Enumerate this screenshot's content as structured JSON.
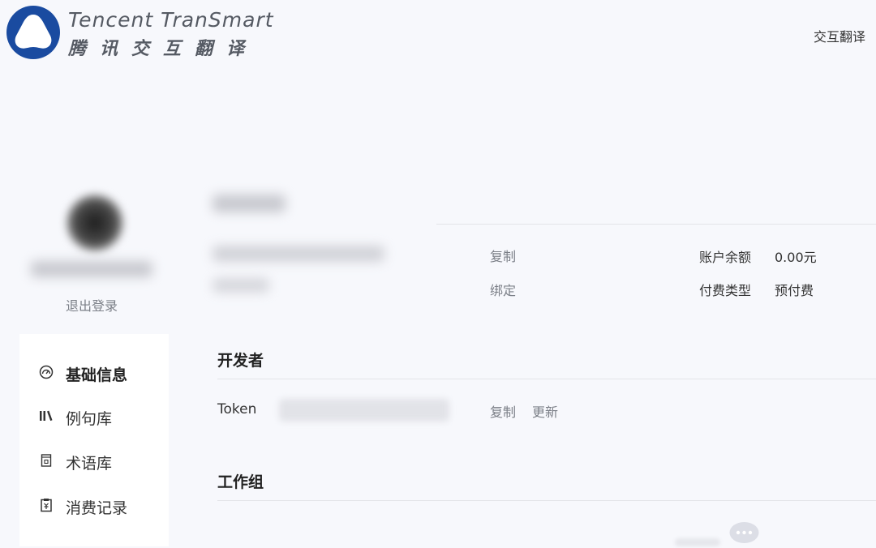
{
  "brand": {
    "name_en": "Tencent TranSmart",
    "name_cn": "腾讯交互翻译"
  },
  "header": {
    "top_link": "交互翻译"
  },
  "profile": {
    "logout_label": "退出登录",
    "copy_label": "复制",
    "bind_label": "绑定",
    "balance_label": "账户余额",
    "balance_value": "0.00元",
    "pay_type_label": "付费类型",
    "pay_type_value": "预付费"
  },
  "sidebar": {
    "items": [
      {
        "label": "基础信息",
        "icon": "dashboard-icon",
        "active": true
      },
      {
        "label": "例句库",
        "icon": "library-icon",
        "active": false
      },
      {
        "label": "术语库",
        "icon": "term-book-icon",
        "active": false
      },
      {
        "label": "消费记录",
        "icon": "receipt-icon",
        "active": false
      }
    ]
  },
  "developer": {
    "title": "开发者",
    "token_label": "Token",
    "copy_label": "复制",
    "refresh_label": "更新"
  },
  "workgroup": {
    "title": "工作组"
  },
  "colors": {
    "page_bg": "#f7f8fc",
    "logo_blue": "#1a4ba0",
    "text_dark": "#333333",
    "text_gray": "#7b7f87"
  }
}
